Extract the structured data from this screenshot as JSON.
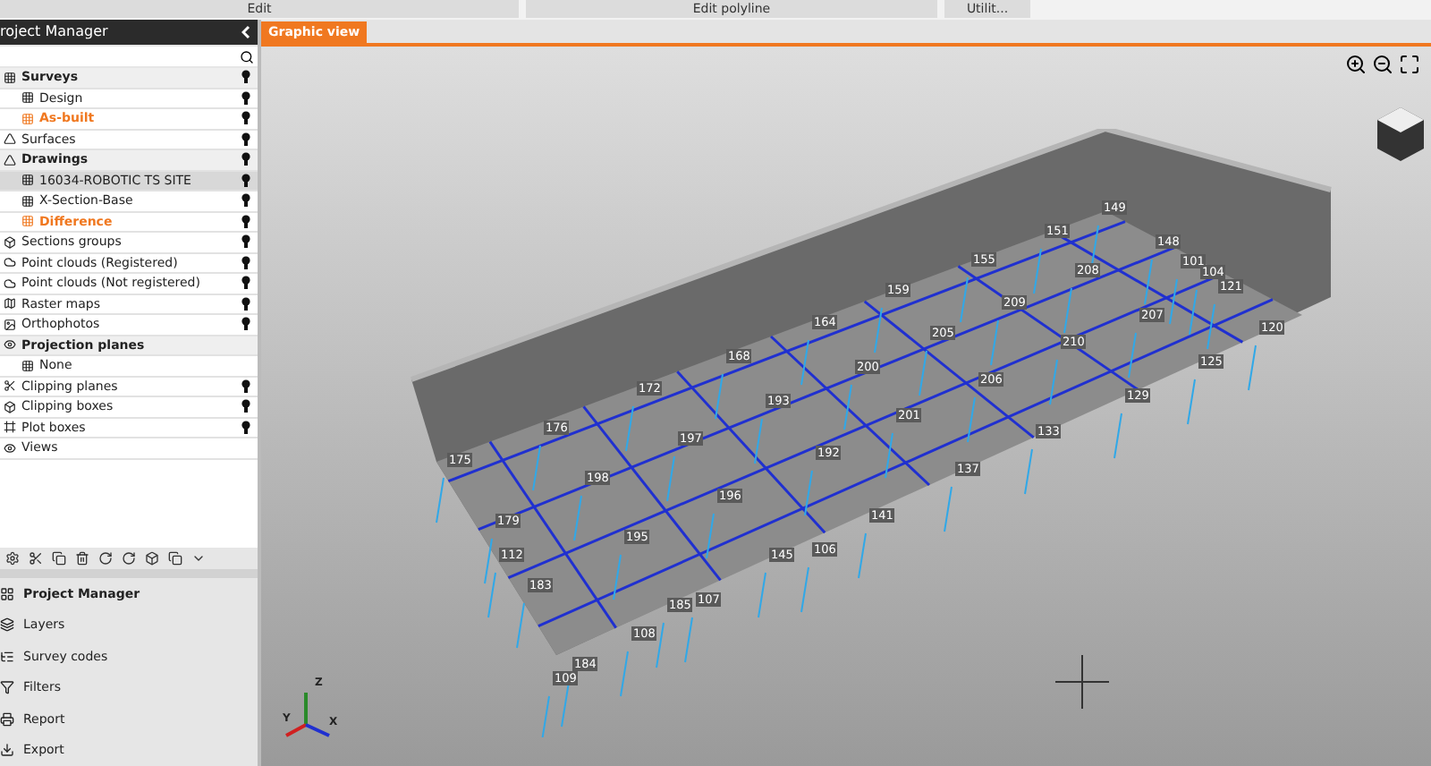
{
  "menu_bar": [
    {
      "label": "Edit"
    },
    {
      "label": "Edit polyline"
    },
    {
      "label": "Utilit..."
    }
  ],
  "panel": {
    "title": "roject Manager",
    "tree": [
      {
        "label": "Surveys",
        "kind": "group",
        "visible": true,
        "highlighted": false,
        "selected": false,
        "children": [
          {
            "label": "Design",
            "kind": "child",
            "visible": true,
            "highlighted": false,
            "selected": false
          },
          {
            "label": "As-built",
            "kind": "child",
            "visible": true,
            "highlighted": true,
            "selected": false
          }
        ]
      },
      {
        "label": "Surfaces",
        "kind": "item",
        "visible": true,
        "highlighted": false,
        "selected": false
      },
      {
        "label": "Drawings",
        "kind": "group",
        "visible": true,
        "highlighted": false,
        "selected": false,
        "children": [
          {
            "label": "16034-ROBOTIC TS SITE",
            "kind": "child",
            "visible": true,
            "highlighted": false,
            "selected": true
          },
          {
            "label": "X-Section-Base",
            "kind": "child",
            "visible": true,
            "highlighted": false,
            "selected": false
          },
          {
            "label": "Difference",
            "kind": "child",
            "visible": true,
            "highlighted": true,
            "selected": false
          }
        ]
      },
      {
        "label": "Sections groups",
        "kind": "item",
        "visible": true,
        "highlighted": false,
        "selected": false
      },
      {
        "label": "Point clouds (Registered)",
        "kind": "item",
        "visible": true,
        "highlighted": false,
        "selected": false
      },
      {
        "label": "Point clouds (Not registered)",
        "kind": "item",
        "visible": true,
        "highlighted": false,
        "selected": false
      },
      {
        "label": "Raster maps",
        "kind": "item",
        "visible": true,
        "highlighted": false,
        "selected": false
      },
      {
        "label": "Orthophotos",
        "kind": "item",
        "visible": true,
        "highlighted": false,
        "selected": false
      },
      {
        "label": "Projection planes",
        "kind": "group",
        "visible": false,
        "highlighted": false,
        "selected": false,
        "children": [
          {
            "label": "None",
            "kind": "child",
            "visible": false,
            "highlighted": false,
            "selected": false
          }
        ]
      },
      {
        "label": "Clipping planes",
        "kind": "item",
        "visible": true,
        "highlighted": false,
        "selected": false
      },
      {
        "label": "Clipping boxes",
        "kind": "item",
        "visible": true,
        "highlighted": false,
        "selected": false
      },
      {
        "label": "Plot boxes",
        "kind": "item",
        "visible": true,
        "highlighted": false,
        "selected": false
      },
      {
        "label": "Views",
        "kind": "item",
        "visible": false,
        "highlighted": false,
        "selected": false
      }
    ],
    "nav": [
      {
        "label": "Project Manager",
        "selected": true
      },
      {
        "label": "Layers",
        "selected": false
      },
      {
        "label": "Survey codes",
        "selected": false
      },
      {
        "label": "Filters",
        "selected": false
      },
      {
        "label": "Report",
        "selected": false
      },
      {
        "label": "Export",
        "selected": false
      }
    ]
  },
  "tabs": [
    {
      "label": "Graphic view",
      "selected": true
    }
  ],
  "viewport": {
    "point_labels": [
      "175",
      "176",
      "172",
      "168",
      "164",
      "159",
      "155",
      "151",
      "149",
      "148",
      "101",
      "104",
      "121",
      "120",
      "125",
      "129",
      "133",
      "137",
      "141",
      "145",
      "106",
      "185",
      "107",
      "108",
      "184",
      "109",
      "183",
      "112",
      "179",
      "198",
      "195",
      "196",
      "197",
      "192",
      "193",
      "200",
      "201",
      "205",
      "206",
      "209",
      "210",
      "208",
      "207"
    ],
    "axes": [
      "Z",
      "Y",
      "X"
    ]
  }
}
